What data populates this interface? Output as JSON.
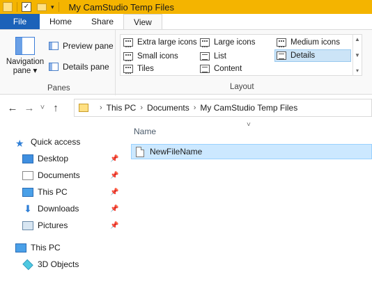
{
  "titlebar": {
    "title": "My CamStudio Temp Files",
    "colors": {
      "bar": "#f4b400"
    }
  },
  "tabs": [
    {
      "label": "File"
    },
    {
      "label": "Home"
    },
    {
      "label": "Share"
    },
    {
      "label": "View"
    }
  ],
  "ribbon": {
    "panes": {
      "navigation_pane_label_line1": "Navigation",
      "navigation_pane_label_line2": "pane ▾",
      "preview_pane_label": "Preview pane",
      "details_pane_label": "Details pane",
      "group_label": "Panes"
    },
    "layout": {
      "items": [
        {
          "label": "Extra large icons"
        },
        {
          "label": "Large icons"
        },
        {
          "label": "Medium icons"
        },
        {
          "label": "Small icons"
        },
        {
          "label": "List"
        },
        {
          "label": "Details"
        },
        {
          "label": "Tiles"
        },
        {
          "label": "Content"
        }
      ],
      "selected": "Details",
      "group_label": "Layout"
    }
  },
  "address": {
    "back_icon": "←",
    "forward_icon": "→",
    "recent_icon": "˅",
    "up_icon": "↑",
    "breadcrumb": [
      "This PC",
      "Documents",
      "My CamStudio Temp Files"
    ]
  },
  "navtree": {
    "quick_access": "Quick access",
    "items": [
      {
        "label": "Desktop",
        "icon": "desktop-icon",
        "pinned": true
      },
      {
        "label": "Documents",
        "icon": "documents-icon",
        "pinned": true
      },
      {
        "label": "This PC",
        "icon": "this-pc-icon",
        "pinned": true
      },
      {
        "label": "Downloads",
        "icon": "downloads-icon",
        "pinned": true
      },
      {
        "label": "Pictures",
        "icon": "pictures-icon",
        "pinned": true
      }
    ],
    "this_pc": "This PC",
    "this_pc_children": [
      {
        "label": "3D Objects",
        "icon": "3d-objects-icon"
      }
    ]
  },
  "content": {
    "column_header": "Name",
    "files": [
      {
        "name": "NewFileName",
        "selected": true
      }
    ]
  }
}
